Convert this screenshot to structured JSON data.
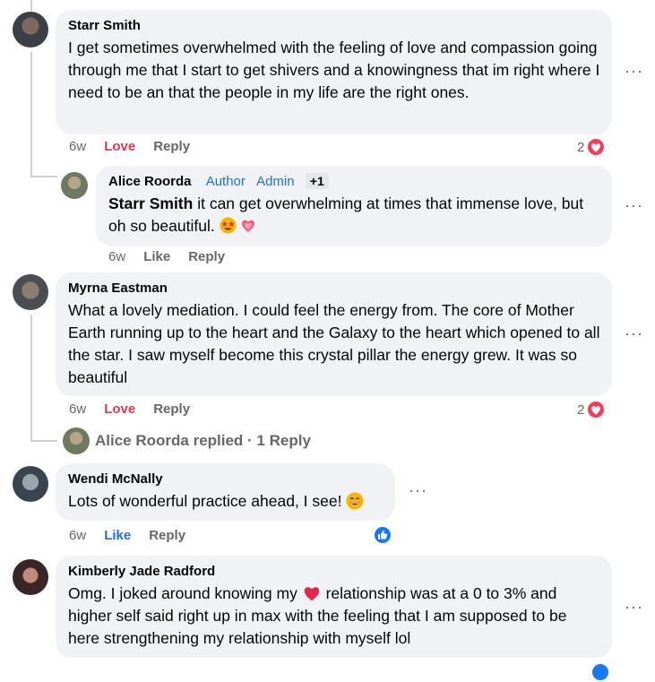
{
  "comments": [
    {
      "author": "Starr Smith",
      "text": "I get sometimes overwhelmed with the feeling of love and compassion going through me that I start to get shivers and a knowingness that im right where I need to be an that the people in my life are the right ones.",
      "time": "6w",
      "reaction_label": "Love",
      "reply_label": "Reply",
      "reaction_count": "2",
      "more_label": "···"
    },
    {
      "author": "Alice Roorda",
      "badges": [
        "Author",
        "Admin",
        "+1"
      ],
      "mention": "Starr Smith",
      "text": "it can get overwhelming at times that immense love, but oh so beautiful.",
      "emojis": [
        "star-struck",
        "sparkling-heart"
      ],
      "time": "6w",
      "reaction_label": "Like",
      "reply_label": "Reply",
      "more_label": "···"
    },
    {
      "author": "Myrna Eastman",
      "text": "What a lovely mediation. I could feel the energy from. The core of Mother Earth running up to the heart and the Galaxy to the heart which opened to all the star. I saw myself become this crystal pillar the energy grew. It was so beautiful",
      "time": "6w",
      "reaction_label": "Love",
      "reply_label": "Reply",
      "reaction_count": "2",
      "more_label": "···",
      "replies_summary": "Alice Roorda replied · 1 Reply"
    },
    {
      "author": "Wendi McNally",
      "text": "Lots of wonderful practice ahead, I see!",
      "emoji": "grinning-face",
      "time": "6w",
      "reaction_label": "Like",
      "reply_label": "Reply",
      "more_label": "···"
    },
    {
      "author": "Kimberly Jade Radford",
      "text_before": "Omg. I joked around knowing my",
      "text_after": "relationship was at a 0 to 3% and higher self said right up in max with the feeling that I am supposed to be here strengthening my relationship with myself lol",
      "emoji": "red-heart",
      "more_label": "···"
    }
  ],
  "colors": {
    "bubble": "#f0f2f5",
    "love": "#e4354c",
    "like": "#216fdb",
    "meta": "#65676b",
    "thread_line": "#ced0d4"
  }
}
